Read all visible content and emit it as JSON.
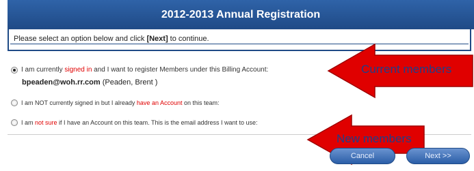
{
  "header": {
    "title": "2012-2013 Annual Registration"
  },
  "instructions": {
    "prefix": "Please select an option below and click ",
    "next_ref": "[Next]",
    "suffix": " to continue."
  },
  "option1": {
    "text_a": "I am currently ",
    "text_red": "signed in",
    "text_b": " and I want to register Members under this Billing Account:",
    "email": "bpeaden@woh.rr.com",
    "name": " (Peaden, Brent )"
  },
  "option2": {
    "text_a": "I am NOT currently signed in but I already ",
    "text_red": "have an Account",
    "text_b": " on this team:"
  },
  "option3": {
    "text_a": "I am ",
    "text_red": "not sure",
    "text_b": " if I have an Account on this team. This is the email address I want to use:"
  },
  "arrows": {
    "current_label": "Current members",
    "new_label": "New members"
  },
  "buttons": {
    "cancel": "Cancel",
    "next": "Next >>"
  },
  "colors": {
    "header": "#1f4a86",
    "arrow": "#e00000",
    "emphasis": "#e00000"
  }
}
